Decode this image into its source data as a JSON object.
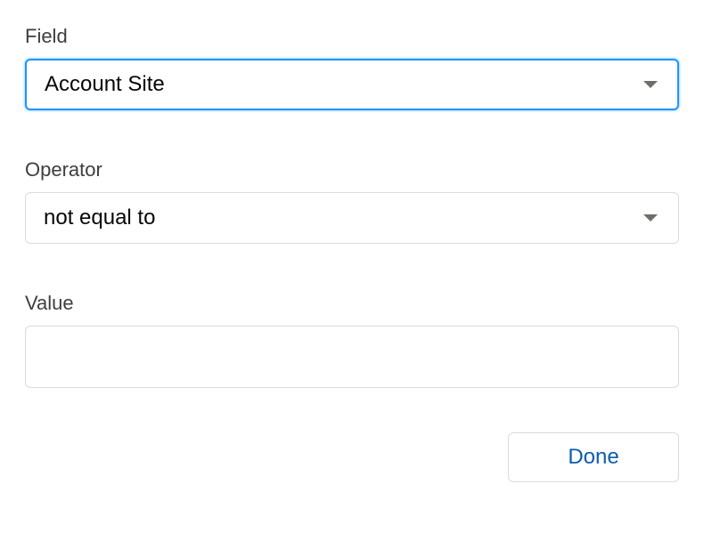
{
  "field": {
    "label": "Field",
    "value": "Account Site"
  },
  "operator": {
    "label": "Operator",
    "value": "not equal to"
  },
  "value_field": {
    "label": "Value",
    "value": ""
  },
  "actions": {
    "done_label": "Done"
  },
  "colors": {
    "focus_border": "#1b96ff",
    "text": "#080707",
    "label": "#3e3e3c",
    "border": "#dddbda",
    "button_text": "#0b5cab"
  }
}
